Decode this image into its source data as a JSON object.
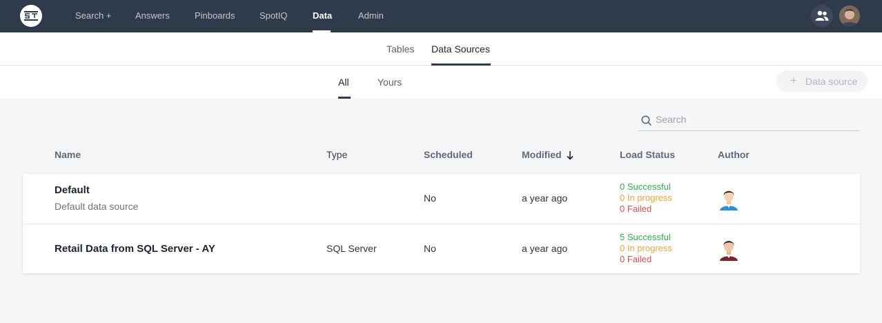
{
  "nav": {
    "items": [
      "Search +",
      "Answers",
      "Pinboards",
      "SpotIQ",
      "Data",
      "Admin"
    ],
    "active": "Data"
  },
  "subtabs": [
    "Tables",
    "Data Sources"
  ],
  "filters": [
    "All",
    "Yours"
  ],
  "add_button": "Data source",
  "search": {
    "placeholder": "Search"
  },
  "columns": [
    "Name",
    "Type",
    "Scheduled",
    "Modified",
    "Load Status",
    "Author"
  ],
  "rows": [
    {
      "name": "Default",
      "description": "Default data source",
      "type": "",
      "scheduled": "No",
      "modified": "a year ago",
      "successful": "0 Successful",
      "in_progress": "0 In progress",
      "failed": "0 Failed"
    },
    {
      "name": "Retail Data from SQL Server - AY",
      "description": "",
      "type": "SQL Server",
      "scheduled": "No",
      "modified": "a year ago",
      "successful": "5 Successful",
      "in_progress": "0 In progress",
      "failed": "0 Failed"
    }
  ],
  "colors": {
    "nav_bg": "#2f3a4a",
    "success": "#2bb34b",
    "in_progress": "#f7a334",
    "failed": "#ea4b4b"
  }
}
